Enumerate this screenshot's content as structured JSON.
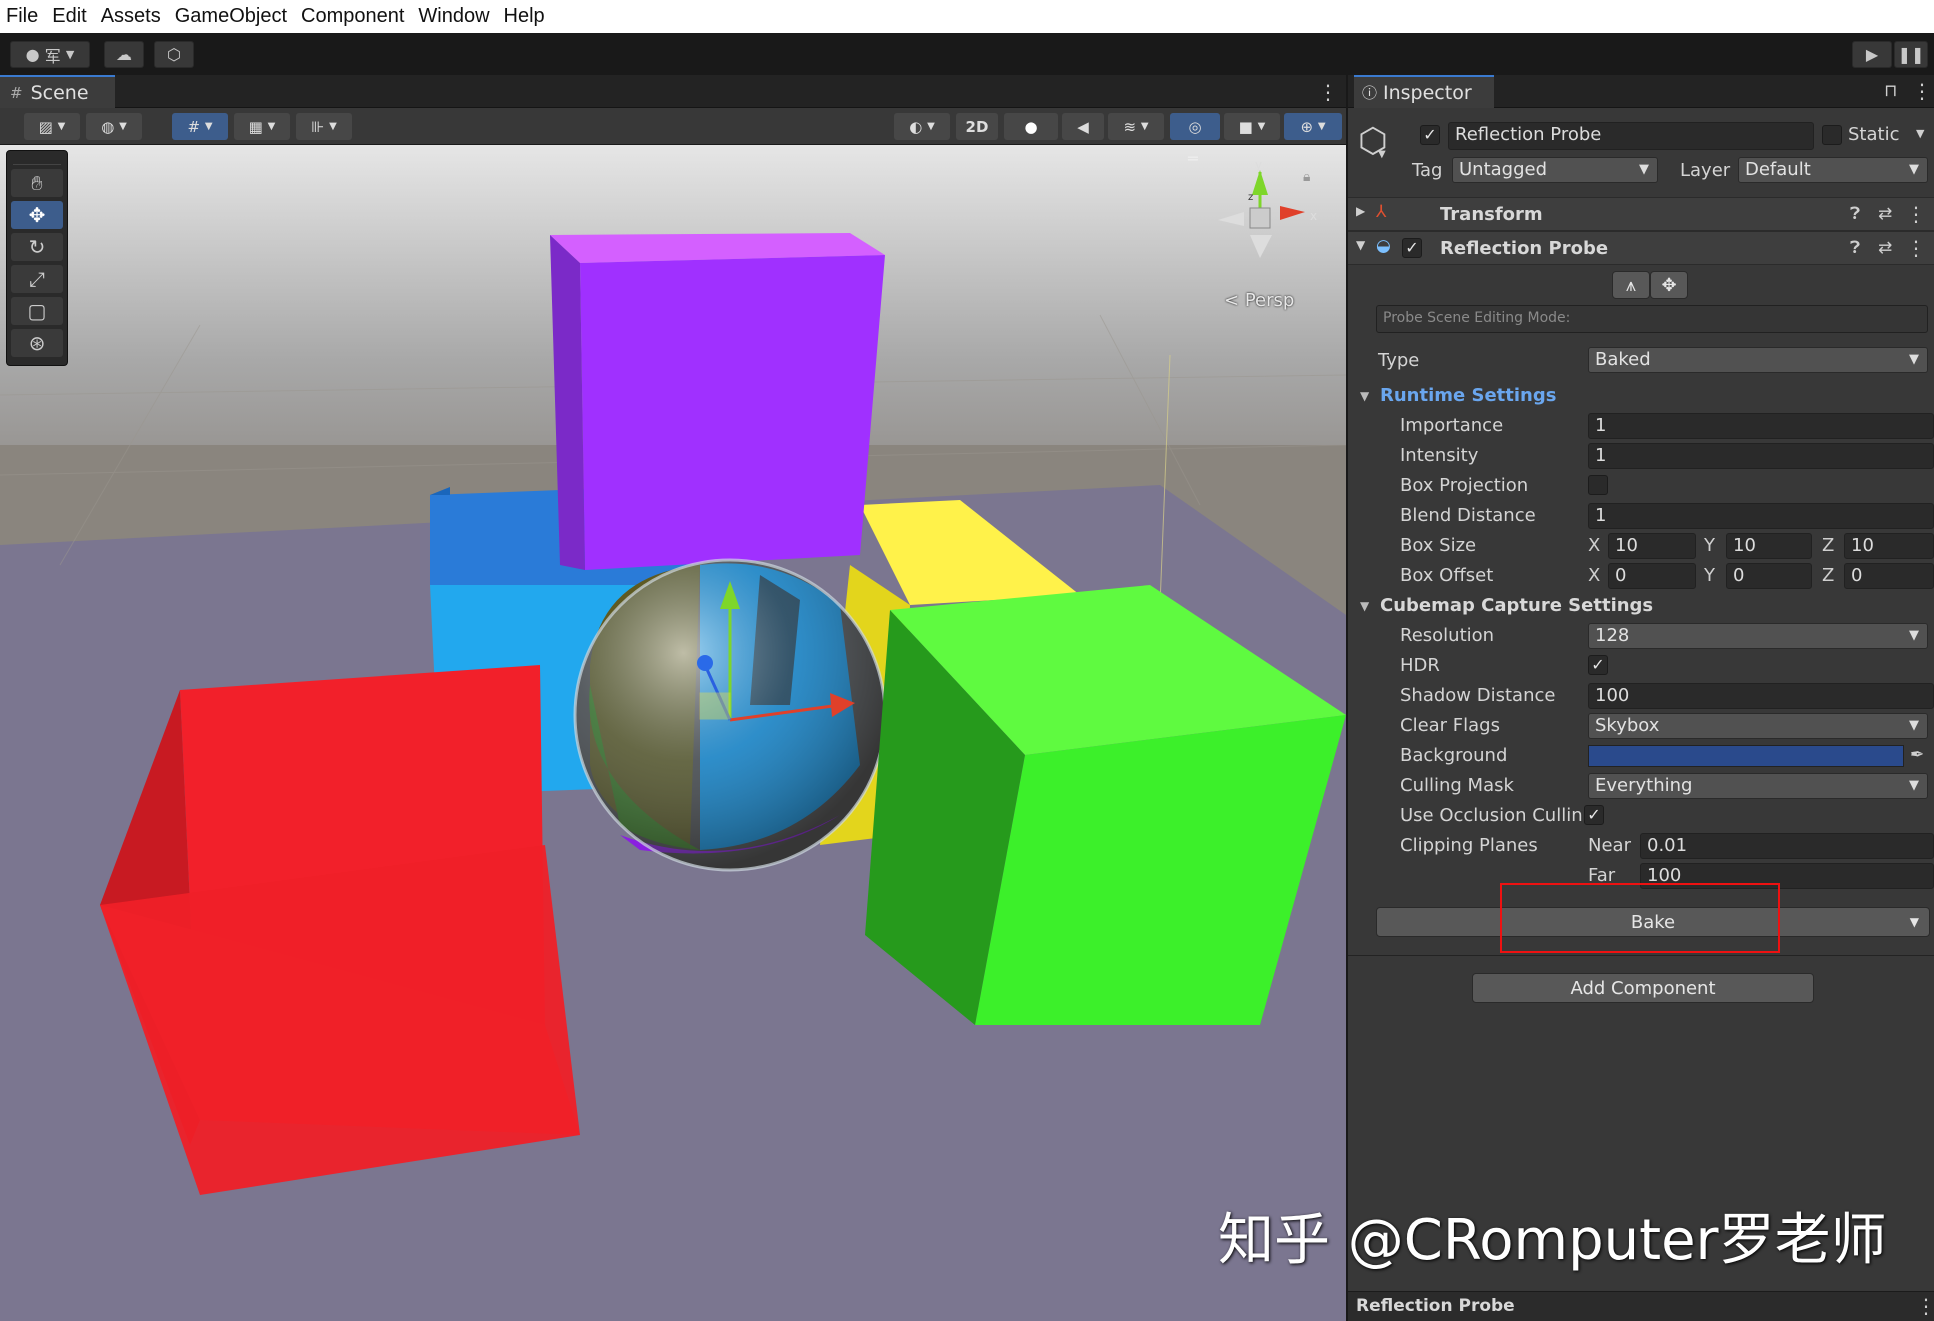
{
  "menu": [
    "File",
    "Edit",
    "Assets",
    "GameObject",
    "Component",
    "Window",
    "Help"
  ],
  "toolbar": {
    "account_icon": "account-icon",
    "cloud_icon": "cloud-icon",
    "collab_icon": "collab-icon",
    "play_icon": "play-icon",
    "pause_icon": "pause-icon",
    "account_glyph": "军"
  },
  "scene": {
    "tab_label": "Scene",
    "mode_2d": "2D",
    "persp_label": "Persp",
    "gizmo_axes": {
      "x": "x",
      "y": "y",
      "z": "z"
    },
    "colors": {
      "sky": "#bcbcbc",
      "ground": "#7a7689",
      "purple": "#a030ff",
      "blue": "#22a8ee",
      "yellow": "#fbf12a",
      "red": "#f2202a",
      "green": "#3cf02a"
    }
  },
  "inspector": {
    "tab_label": "Inspector",
    "object_name": "Reflection Probe",
    "static_label": "Static",
    "tag_label": "Tag",
    "tag_value": "Untagged",
    "layer_label": "Layer",
    "layer_value": "Default",
    "transform_label": "Transform",
    "component_label": "Reflection Probe",
    "probe_mode_placeholder": "Probe Scene Editing Mode:",
    "type_label": "Type",
    "type_value": "Baked",
    "runtime_title": "Runtime Settings",
    "importance_label": "Importance",
    "importance_value": "1",
    "intensity_label": "Intensity",
    "intensity_value": "1",
    "box_projection_label": "Box Projection",
    "blend_distance_label": "Blend Distance",
    "blend_distance_value": "1",
    "box_size_label": "Box Size",
    "box_size": {
      "x": "10",
      "y": "10",
      "z": "10"
    },
    "box_offset_label": "Box Offset",
    "box_offset": {
      "x": "0",
      "y": "0",
      "z": "0"
    },
    "axis_labels": {
      "x": "X",
      "y": "Y",
      "z": "Z"
    },
    "cubemap_title": "Cubemap Capture Settings",
    "resolution_label": "Resolution",
    "resolution_value": "128",
    "hdr_label": "HDR",
    "shadow_distance_label": "Shadow Distance",
    "shadow_distance_value": "100",
    "clear_flags_label": "Clear Flags",
    "clear_flags_value": "Skybox",
    "background_label": "Background",
    "background_color": "#2a4a8c",
    "culling_mask_label": "Culling Mask",
    "culling_mask_value": "Everything",
    "occlusion_label": "Use Occlusion Cullin",
    "clipping_label": "Clipping Planes",
    "near_label": "Near",
    "near_value": "0.01",
    "far_label": "Far",
    "far_value": "100",
    "bake_label": "Bake",
    "add_component_label": "Add Component",
    "footer_label": "Reflection Probe",
    "check_glyph": "✓"
  },
  "watermark": "知乎 @CRomputer罗老师"
}
